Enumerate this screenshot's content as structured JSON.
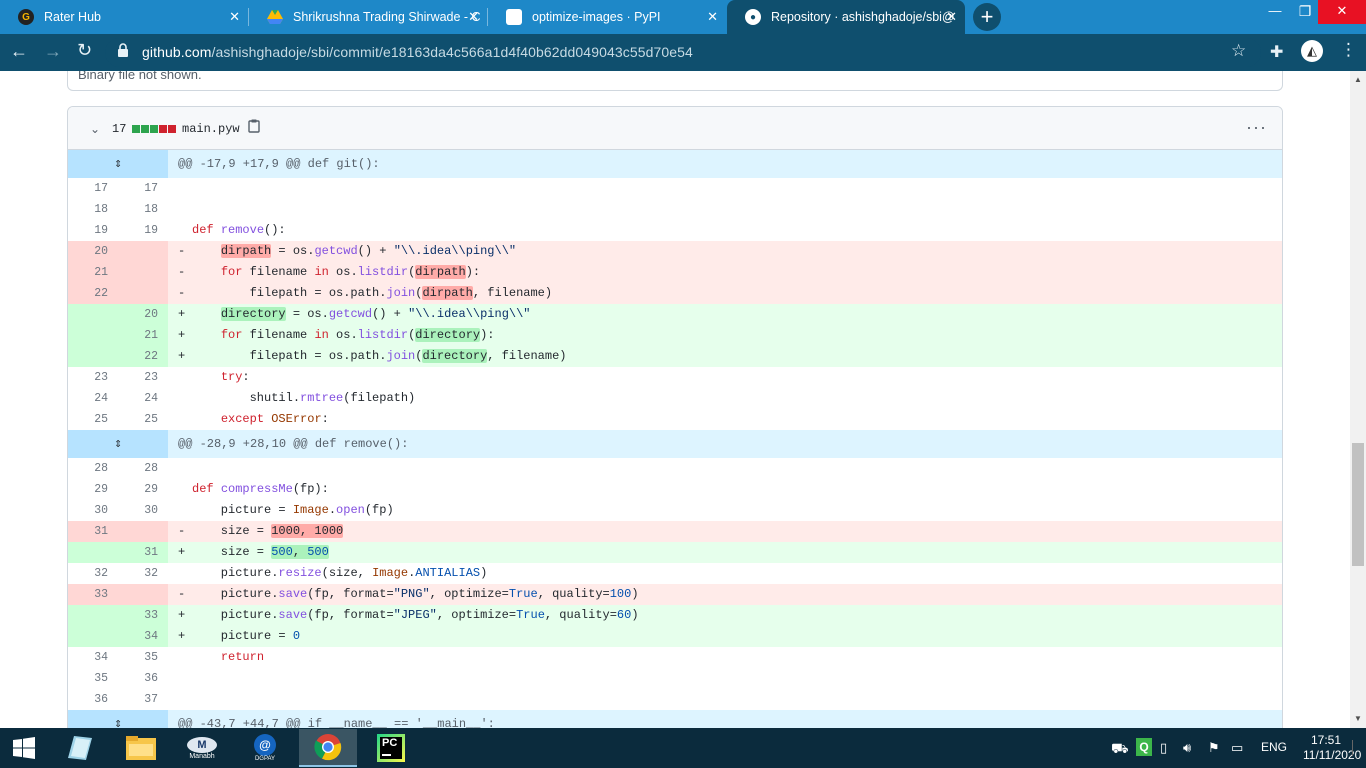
{
  "browser": {
    "tabs": [
      {
        "title": "Rater Hub",
        "favicon": "rater-hub-icon",
        "close": "✕"
      },
      {
        "title": "Shrikrushna Trading Shirwade - C",
        "favicon": "google-drive-icon",
        "close": "✕"
      },
      {
        "title": "optimize-images · PyPI",
        "favicon": "pypi-icon",
        "close": "✕"
      },
      {
        "title": "Repository · ashishghadoje/sbi@",
        "favicon": "github-icon",
        "close": "✕"
      }
    ],
    "new_tab": "+",
    "url_host": "github.com",
    "url_path": "/ashishghadoje/sbi/commit/e18163da4c566a1d4f40b62dd049043c55d70e54"
  },
  "page": {
    "prev_file_message": "Binary file not shown.",
    "file": {
      "changes_count": "17",
      "name": "main.pyw",
      "diffstat_colors": [
        "#2da44e",
        "#2da44e",
        "#2da44e",
        "#cf222e",
        "#cf222e",
        "#cf222e",
        "#d0d7de"
      ]
    },
    "diff_rows": [
      {
        "type": "hunk",
        "text": "@@ -17,9 +17,9 @@ def git():"
      },
      {
        "type": "ctx",
        "old": "17",
        "new": "17",
        "sign": "",
        "html": ""
      },
      {
        "type": "ctx",
        "old": "18",
        "new": "18",
        "sign": "",
        "html": ""
      },
      {
        "type": "ctx",
        "old": "19",
        "new": "19",
        "sign": "",
        "html": "<span class='kw'>def</span> <span class='fn'>remove</span>():"
      },
      {
        "type": "del",
        "old": "20",
        "new": "",
        "sign": "-",
        "html": "    <span class='hd'>dirpath</span> = os.<span class='fn'>getcwd</span>() + <span class='st'>\"\\\\.idea\\\\ping\\\\\"</span>"
      },
      {
        "type": "del",
        "old": "21",
        "new": "",
        "sign": "-",
        "html": "    <span class='kw'>for</span> filename <span class='kw'>in</span> os.<span class='fn'>listdir</span>(<span class='hd'>dirpath</span>):"
      },
      {
        "type": "del",
        "old": "22",
        "new": "",
        "sign": "-",
        "html": "        filepath = os.path.<span class='fn'>join</span>(<span class='hd'>dirpath</span>, filename)"
      },
      {
        "type": "add",
        "old": "",
        "new": "20",
        "sign": "+",
        "html": "    <span class='ha'>directory</span> = os.<span class='fn'>getcwd</span>() + <span class='st'>\"\\\\.idea\\\\ping\\\\\"</span>"
      },
      {
        "type": "add",
        "old": "",
        "new": "21",
        "sign": "+",
        "html": "    <span class='kw'>for</span> filename <span class='kw'>in</span> os.<span class='fn'>listdir</span>(<span class='ha'>directory</span>):"
      },
      {
        "type": "add",
        "old": "",
        "new": "22",
        "sign": "+",
        "html": "        filepath = os.path.<span class='fn'>join</span>(<span class='ha'>directory</span>, filename)"
      },
      {
        "type": "ctx",
        "old": "23",
        "new": "23",
        "sign": "",
        "html": "    <span class='kw'>try</span>:"
      },
      {
        "type": "ctx",
        "old": "24",
        "new": "24",
        "sign": "",
        "html": "        shutil.<span class='fn'>rmtree</span>(filepath)"
      },
      {
        "type": "ctx",
        "old": "25",
        "new": "25",
        "sign": "",
        "html": "    <span class='kw'>except</span> <span class='ob'>OSError</span>:"
      },
      {
        "type": "hunk",
        "text": "@@ -28,9 +28,10 @@ def remove():"
      },
      {
        "type": "ctx",
        "old": "28",
        "new": "28",
        "sign": "",
        "html": ""
      },
      {
        "type": "ctx",
        "old": "29",
        "new": "29",
        "sign": "",
        "html": "<span class='kw'>def</span> <span class='fn'>compressMe</span>(fp):"
      },
      {
        "type": "ctx",
        "old": "30",
        "new": "30",
        "sign": "",
        "html": "    picture = <span class='ob'>Image</span>.<span class='fn'>open</span>(fp)"
      },
      {
        "type": "del",
        "old": "31",
        "new": "",
        "sign": "-",
        "html": "    size = <span class='hd'>1000, 1000</span>"
      },
      {
        "type": "add",
        "old": "",
        "new": "31",
        "sign": "+",
        "html": "    size = <span class='ha'><span class='nm'>500</span>, <span class='nm'>500</span></span>"
      },
      {
        "type": "ctx",
        "old": "32",
        "new": "32",
        "sign": "",
        "html": "    picture.<span class='fn'>resize</span>(size, <span class='ob'>Image</span>.<span class='nm'>ANTIALIAS</span>)"
      },
      {
        "type": "del",
        "old": "33",
        "new": "",
        "sign": "-",
        "html": "    picture.<span class='fn'>save</span>(fp, format=<span class='st'>\"PNG\"</span>, optimize=<span class='nm'>True</span>, quality=<span class='nm'>100</span>)"
      },
      {
        "type": "add",
        "old": "",
        "new": "33",
        "sign": "+",
        "html": "    picture.<span class='fn'>save</span>(fp, format=<span class='st'>\"JPEG\"</span>, optimize=<span class='nm'>True</span>, quality=<span class='nm'>60</span>)"
      },
      {
        "type": "add",
        "old": "",
        "new": "34",
        "sign": "+",
        "html": "    picture = <span class='nm'>0</span>"
      },
      {
        "type": "ctx",
        "old": "34",
        "new": "35",
        "sign": "",
        "html": "    <span class='kw'>return</span>"
      },
      {
        "type": "ctx",
        "old": "35",
        "new": "36",
        "sign": "",
        "html": ""
      },
      {
        "type": "ctx",
        "old": "36",
        "new": "37",
        "sign": "",
        "html": ""
      },
      {
        "type": "hunk",
        "text": "@@ -43,7 +44,7 @@ if __name__ == '__main__':"
      }
    ]
  },
  "taskbar": {
    "apps": [
      "Manabh",
      "DGPAY"
    ],
    "lang": "ENG",
    "time": "17:51",
    "date": "11/11/2020"
  }
}
